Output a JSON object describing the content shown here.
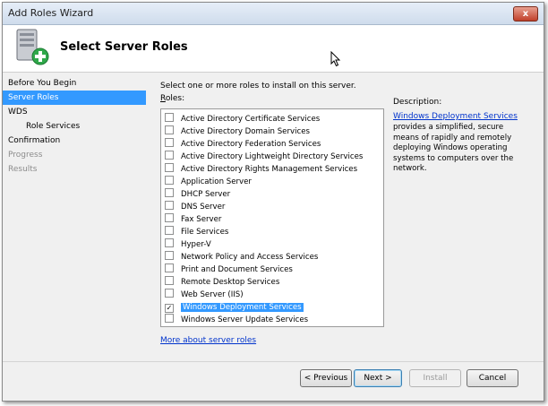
{
  "window": {
    "title": "Add Roles Wizard",
    "close_glyph": "x"
  },
  "header": {
    "title": "Select Server Roles",
    "icon": "server-add-icon"
  },
  "nav": {
    "items": [
      {
        "label": "Before You Begin",
        "state": "normal"
      },
      {
        "label": "Server Roles",
        "state": "selected"
      },
      {
        "label": "WDS",
        "state": "normal"
      },
      {
        "label": "Role Services",
        "state": "sub"
      },
      {
        "label": "Confirmation",
        "state": "normal"
      },
      {
        "label": "Progress",
        "state": "disabled"
      },
      {
        "label": "Results",
        "state": "disabled"
      }
    ]
  },
  "main": {
    "instruction": "Select one or more roles to install on this server.",
    "roles_label_prefix": "R",
    "roles_label_rest": "oles:",
    "roles": [
      {
        "label": "Active Directory Certificate Services",
        "checked": false
      },
      {
        "label": "Active Directory Domain Services",
        "checked": false
      },
      {
        "label": "Active Directory Federation Services",
        "checked": false
      },
      {
        "label": "Active Directory Lightweight Directory Services",
        "checked": false
      },
      {
        "label": "Active Directory Rights Management Services",
        "checked": false
      },
      {
        "label": "Application Server",
        "checked": false
      },
      {
        "label": "DHCP Server",
        "checked": false
      },
      {
        "label": "DNS Server",
        "checked": false
      },
      {
        "label": "Fax Server",
        "checked": false
      },
      {
        "label": "File Services",
        "checked": false
      },
      {
        "label": "Hyper-V",
        "checked": false
      },
      {
        "label": "Network Policy and Access Services",
        "checked": false
      },
      {
        "label": "Print and Document Services",
        "checked": false
      },
      {
        "label": "Remote Desktop Services",
        "checked": false
      },
      {
        "label": "Web Server (IIS)",
        "checked": false
      },
      {
        "label": "Windows Deployment Services",
        "checked": true,
        "selected": true
      },
      {
        "label": "Windows Server Update Services",
        "checked": false
      }
    ],
    "more_link": "More about server roles",
    "description_label": "Description:",
    "description_link": "Windows Deployment Services",
    "description_text": "provides a simplified, secure means of rapidly and remotely deploying Windows operating systems to computers over the network.",
    "check_glyph": "✓"
  },
  "buttons": {
    "previous": "< Previous",
    "next": "Next >",
    "install": "Install",
    "cancel": "Cancel"
  }
}
